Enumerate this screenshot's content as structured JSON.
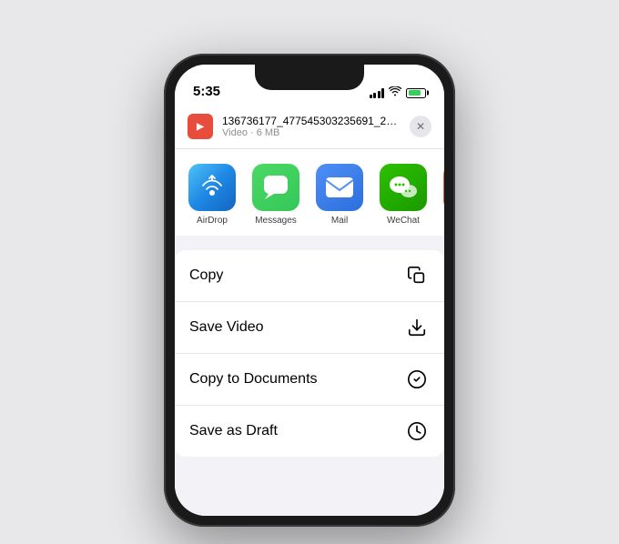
{
  "phone": {
    "status_bar": {
      "time": "5:35"
    },
    "share_preview": {
      "file_name": "136736177_477545303235691_2122...",
      "file_meta": "Video · 6 MB",
      "close_label": "✕",
      "file_icon_label": "▶"
    },
    "apps": [
      {
        "id": "airdrop",
        "label": "AirDrop"
      },
      {
        "id": "messages",
        "label": "Messages"
      },
      {
        "id": "mail",
        "label": "Mail"
      },
      {
        "id": "wechat",
        "label": "WeChat"
      },
      {
        "id": "more",
        "label": ""
      }
    ],
    "actions": [
      {
        "id": "copy",
        "label": "Copy",
        "icon": "copy"
      },
      {
        "id": "save-video",
        "label": "Save Video",
        "icon": "save"
      },
      {
        "id": "copy-to-documents",
        "label": "Copy to Documents",
        "icon": "documents"
      },
      {
        "id": "save-as-draft",
        "label": "Save as Draft",
        "icon": "draft"
      }
    ]
  }
}
